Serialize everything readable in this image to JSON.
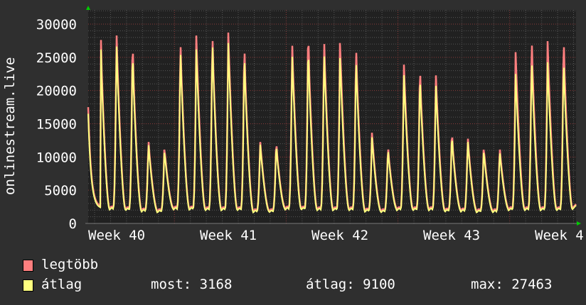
{
  "chart_data": {
    "type": "line",
    "ylabel": "onlinestream.live",
    "ylim": [
      0,
      32000
    ],
    "y_ticks": [
      "0",
      "5000",
      "10000",
      "15000",
      "20000",
      "25000",
      "30000"
    ],
    "x_ticks": [
      "Week 40",
      "Week 41",
      "Week 42",
      "Week 43",
      "Week 4"
    ],
    "grid": true,
    "legend_placement": "bottom-left",
    "series": [
      {
        "name": "legtöbb",
        "color": "#ff7f7f",
        "start": 17500,
        "daily_peaks": [
          28700,
          28700,
          26700,
          12500,
          11500,
          27200,
          28300,
          28300,
          28900,
          26500,
          12400,
          12100,
          27200,
          28000,
          27600,
          27600,
          26400,
          13700,
          11500,
          24100,
          23100,
          22600,
          13500,
          13000,
          11500,
          11400,
          25800,
          27600,
          27600,
          27500
        ],
        "daily_min": [
          2400,
          2400,
          2300,
          2100,
          2000,
          2400,
          2400,
          2300,
          2300,
          2300,
          2000,
          2000,
          2400,
          2400,
          2300,
          2300,
          2300,
          2100,
          2000,
          2300,
          2300,
          2300,
          2100,
          2100,
          2000,
          2000,
          2300,
          2300,
          2300,
          2300
        ],
        "end": 3300
      },
      {
        "name": "átlag",
        "color": "#ffff7f",
        "start": 16500,
        "daily_peaks": [
          27200,
          27000,
          25200,
          12000,
          11000,
          26000,
          26200,
          27300,
          27300,
          25000,
          12000,
          11700,
          25500,
          25800,
          25700,
          25300,
          24500,
          13000,
          11100,
          22500,
          21700,
          21000,
          13000,
          12500,
          11000,
          10800,
          22500,
          24500,
          24400,
          24300
        ],
        "daily_min": [
          2200,
          2200,
          2100,
          1900,
          1800,
          2200,
          2200,
          2100,
          2100,
          2100,
          1800,
          1800,
          2200,
          2200,
          2100,
          2100,
          2100,
          1900,
          1800,
          2100,
          2100,
          2100,
          1900,
          1900,
          1800,
          1800,
          2100,
          2100,
          2100,
          2100
        ],
        "end": 3168
      }
    ]
  },
  "legend": {
    "max_label": "legtöbb",
    "avg_label": "átlag",
    "now": "most: 3168",
    "avg": "átlag: 9100",
    "max": "max: 27463"
  },
  "colors": {
    "background": "#2f2f2f",
    "plot": "#212121",
    "grid_minor": "#555555",
    "grid_major": "#8a3a3a",
    "arrow": "#00cc00"
  }
}
